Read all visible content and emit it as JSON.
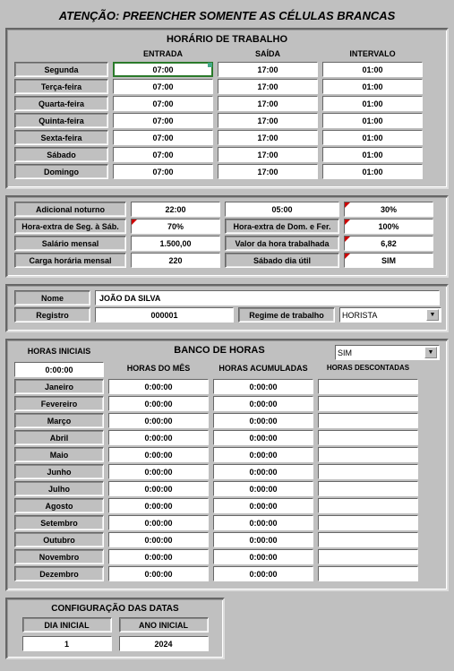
{
  "title": "ATENÇÃO: PREENCHER SOMENTE AS CÉLULAS BRANCAS",
  "horario": {
    "title": "HORÁRIO DE TRABALHO",
    "headers": [
      "ENTRADA",
      "SAÍDA",
      "INTERVALO"
    ],
    "days": [
      "Segunda",
      "Terça-feira",
      "Quarta-feira",
      "Quinta-feira",
      "Sexta-feira",
      "Sábado",
      "Domingo"
    ],
    "rows": [
      [
        "07:00",
        "17:00",
        "01:00"
      ],
      [
        "07:00",
        "17:00",
        "01:00"
      ],
      [
        "07:00",
        "17:00",
        "01:00"
      ],
      [
        "07:00",
        "17:00",
        "01:00"
      ],
      [
        "07:00",
        "17:00",
        "01:00"
      ],
      [
        "07:00",
        "17:00",
        "01:00"
      ],
      [
        "07:00",
        "17:00",
        "01:00"
      ]
    ]
  },
  "extras": {
    "r1": {
      "l1": "Adicional noturno",
      "v1": "22:00",
      "l2": "",
      "v2": "05:00",
      "l3": "",
      "v3": "30%"
    },
    "r2": {
      "l1": "Hora-extra de Seg. à Sáb.",
      "v1": "70%",
      "l2": "Hora-extra de Dom. e Fer.",
      "v2": "",
      "l3": "",
      "v3": "100%"
    },
    "r3": {
      "l1": "Salário mensal",
      "v1": "1.500,00",
      "l2": "Valor da hora trabalhada",
      "v2": "",
      "l3": "",
      "v3": "6,82"
    },
    "r4": {
      "l1": "Carga horária mensal",
      "v1": "220",
      "l2": "Sábado dia útil",
      "v2": "",
      "l3": "",
      "v3": "SIM"
    }
  },
  "pessoa": {
    "nomeLabel": "Nome",
    "nome": "JOÃO DA SILVA",
    "regLabel": "Registro",
    "reg": "000001",
    "regimeLabel": "Regime de trabalho",
    "regime": "HORISTA"
  },
  "banco": {
    "title": "BANCO DE HORAS",
    "initLabel": "HORAS INICIAIS",
    "init": "0:00:00",
    "sel": "SIM",
    "headers": [
      "HORAS DO MÊS",
      "HORAS ACUMULADAS",
      "HORAS DESCONTADAS"
    ],
    "months": [
      "Janeiro",
      "Fevereiro",
      "Março",
      "Abril",
      "Maio",
      "Junho",
      "Julho",
      "Agosto",
      "Setembro",
      "Outubro",
      "Novembro",
      "Dezembro"
    ],
    "rows": [
      [
        "0:00:00",
        "0:00:00",
        ""
      ],
      [
        "0:00:00",
        "0:00:00",
        ""
      ],
      [
        "0:00:00",
        "0:00:00",
        ""
      ],
      [
        "0:00:00",
        "0:00:00",
        ""
      ],
      [
        "0:00:00",
        "0:00:00",
        ""
      ],
      [
        "0:00:00",
        "0:00:00",
        ""
      ],
      [
        "0:00:00",
        "0:00:00",
        ""
      ],
      [
        "0:00:00",
        "0:00:00",
        ""
      ],
      [
        "0:00:00",
        "0:00:00",
        ""
      ],
      [
        "0:00:00",
        "0:00:00",
        ""
      ],
      [
        "0:00:00",
        "0:00:00",
        ""
      ],
      [
        "0:00:00",
        "0:00:00",
        ""
      ]
    ]
  },
  "config": {
    "title": "CONFIGURAÇÃO DAS DATAS",
    "diaLabel": "DIA INICIAL",
    "dia": "1",
    "anoLabel": "ANO INICIAL",
    "ano": "2024"
  }
}
